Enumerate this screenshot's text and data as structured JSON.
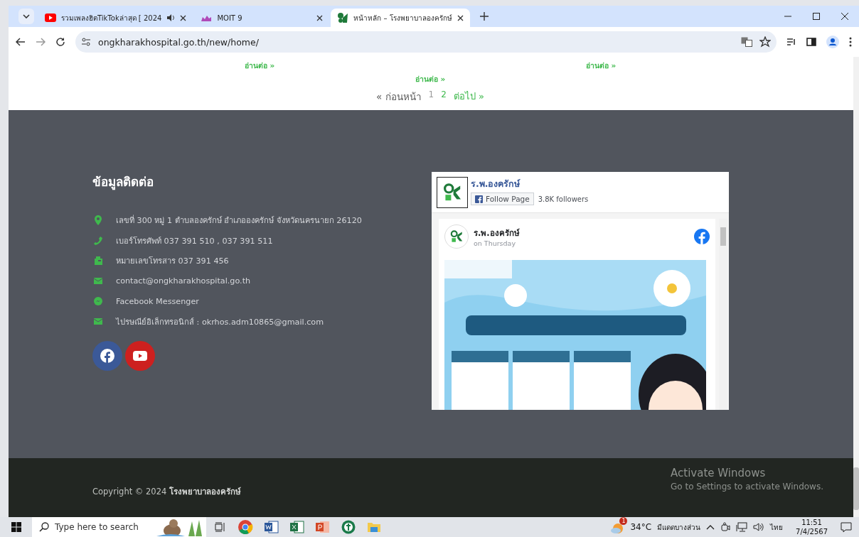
{
  "browser": {
    "tabs": [
      {
        "title": "รวมเพลงฮิตTikTokล่าสุด [ 2024",
        "selected": false,
        "playing_audio": true,
        "kind": "video"
      },
      {
        "title": "MOIT 9",
        "selected": false,
        "playing_audio": false,
        "kind": "moit"
      },
      {
        "title": "หน้าหลัก – โรงพยาบาลองครักษ์",
        "selected": true,
        "playing_audio": false,
        "kind": "hospital"
      }
    ],
    "url": "ongkharakhospital.go.th/new/home/"
  },
  "posts": {
    "read_more": [
      "อ่านต่อ »",
      "อ่านต่อ »",
      "อ่านต่อ »"
    ],
    "pagination": [
      {
        "label": "« ก่อนหน้า",
        "kind": "prev",
        "selected": false
      },
      {
        "label": "1",
        "kind": "page",
        "selected": true
      },
      {
        "label": "2",
        "kind": "page",
        "selected": false
      },
      {
        "label": "ต่อไป »",
        "kind": "next",
        "selected": false
      }
    ]
  },
  "contact": {
    "heading": "ข้อมูลติดต่อ",
    "items": [
      {
        "kind": "address",
        "text": "เลขที่ 300 หมู่ 1 ตำบลองครักษ์ อำเภอองครักษ์ จังหวัดนครนายก 26120"
      },
      {
        "kind": "phone",
        "text": "เบอร์โทรศัพท์ 037 391 510 , 037 391 511"
      },
      {
        "kind": "fax",
        "text": "หมายเลขโทรสาร 037 391 456"
      },
      {
        "kind": "email",
        "text": "contact@ongkharakhospital.go.th"
      },
      {
        "kind": "messenger",
        "text": "Facebook Messenger"
      },
      {
        "kind": "email",
        "text": "ไปรษณีย์อิเล็กทรอนิกส์ : okrhos.adm10865@gmail.com"
      }
    ],
    "social": [
      {
        "kind": "facebook"
      },
      {
        "kind": "youtube"
      }
    ]
  },
  "facebook_widget": {
    "page_name": "ร.พ.องครักษ์",
    "follow_button": "Follow Page",
    "followers": "3.8K followers",
    "post": {
      "author": "ร.พ.องครักษ์",
      "time": "on Thursday"
    }
  },
  "footer": {
    "copyright": "Copyright © 2024 **โรงพยาบาลองครักษ์**"
  },
  "activation_notice": {
    "title": "Activate Windows",
    "message": "Go to Settings to activate Windows."
  },
  "taskbar": {
    "search_placeholder": "Type here to search",
    "weather": {
      "badge": "1",
      "temperature": "34°C",
      "condition": "มีแดดบางส่วน"
    },
    "language": "ไทย",
    "time": "11:51",
    "date": "7/4/2567"
  }
}
